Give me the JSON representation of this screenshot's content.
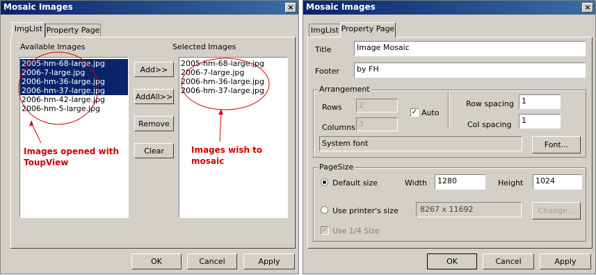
{
  "left_dialog": {
    "title": "Mosaic Images",
    "tabs": [
      "ImgList",
      "Property Page"
    ],
    "available_label": "Available Images",
    "selected_label": "Selected Images",
    "available_images": [
      {
        "name": "2005-hm-68-large.jpg",
        "selected": true
      },
      {
        "name": "2006-7-large.jpg",
        "selected": true
      },
      {
        "name": "2006-hm-36-large.jpg",
        "selected": true
      },
      {
        "name": "2006-hm-37-large.jpg",
        "selected": true
      },
      {
        "name": "2006-hm-42-large.jpg",
        "selected": false
      },
      {
        "name": "2006-hm-5-large.jpg",
        "selected": false
      }
    ],
    "selected_images": [
      "2005-hm-68-large.jpg",
      "2006-7-large.jpg",
      "2006-hm-36-large.jpg",
      "2006-hm-37-large.jpg"
    ],
    "buttons": {
      "add": "Add>>",
      "add_all": "AddAll>>",
      "remove": "Remove",
      "clear": "Clear"
    },
    "annotations": {
      "left": [
        "Images opened with",
        "ToupView"
      ],
      "right": [
        "Images wish to",
        "mosaic"
      ]
    },
    "footer": {
      "ok": "OK",
      "cancel": "Cancel",
      "apply": "Apply"
    }
  },
  "right_dialog": {
    "title": "Mosaic Images",
    "tabs": [
      "ImgList",
      "Property Page"
    ],
    "title_label": "Title",
    "title_value": "Image Mosaic",
    "footer_label": "Footer",
    "footer_value": "by FH",
    "arrangement": {
      "label": "Arrangement",
      "rows_label": "Rows",
      "rows_value": "2",
      "columns_label": "Columns",
      "columns_value": "3",
      "auto_label": "Auto",
      "auto_checked": true,
      "row_spacing_label": "Row spacing",
      "row_spacing_value": "1",
      "col_spacing_label": "Col spacing",
      "col_spacing_value": "1",
      "font_display": "System font",
      "font_button": "Font..."
    },
    "pagesize": {
      "label": "PageSize",
      "default_label": "Default size",
      "default_selected": true,
      "width_label": "Width",
      "width_value": "1280",
      "height_label": "Height",
      "height_value": "1024",
      "printer_label": "Use printer's size",
      "printer_value": "8267 x 11692",
      "change_button": "Change...",
      "quarter_label": "Use 1/4 Size",
      "quarter_checked": true
    },
    "footer": {
      "ok": "OK",
      "cancel": "Cancel",
      "apply": "Apply"
    }
  },
  "colors": {
    "selection": "#0a246a",
    "annotation": "#cc0000",
    "dialog_bg": "#d4d0c8"
  },
  "icons": {
    "close": "close-icon",
    "check": "check-icon",
    "radio": "radio-dot-icon"
  }
}
